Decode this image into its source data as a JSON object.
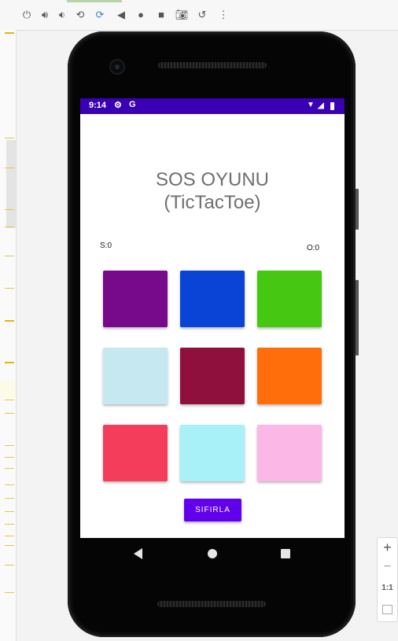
{
  "toolbar": {
    "icons": [
      "power-icon",
      "volume-up-icon",
      "volume-down-icon",
      "rotate-left-icon",
      "rotate-right-icon",
      "back-icon",
      "home-icon",
      "overview-icon",
      "camera-icon",
      "replay-icon",
      "more-icon"
    ]
  },
  "status_bar": {
    "time": "9:14",
    "icons": [
      "settings-icon",
      "google-icon",
      "wifi-icon",
      "signal-icon",
      "battery-icon"
    ]
  },
  "app": {
    "title_line1": "SOS OYUNU",
    "title_line2": "(TicTacToe)",
    "score_s": "S:0",
    "score_o": "O:0",
    "reset_label": "SIFIRLA",
    "accent_color": "#6200ee",
    "status_bar_color": "#3a00b3",
    "cells": [
      {
        "color": "#760a8b"
      },
      {
        "color": "#0a44d6"
      },
      {
        "color": "#46c712"
      },
      {
        "color": "#c6e9f1"
      },
      {
        "color": "#8f103c"
      },
      {
        "color": "#ff6e0a"
      },
      {
        "color": "#f33d5a"
      },
      {
        "color": "#a8f1f8"
      },
      {
        "color": "#fbb7e6"
      }
    ]
  },
  "zoom": {
    "plus": "+",
    "minus": "−",
    "one_to_one": "1:1"
  }
}
